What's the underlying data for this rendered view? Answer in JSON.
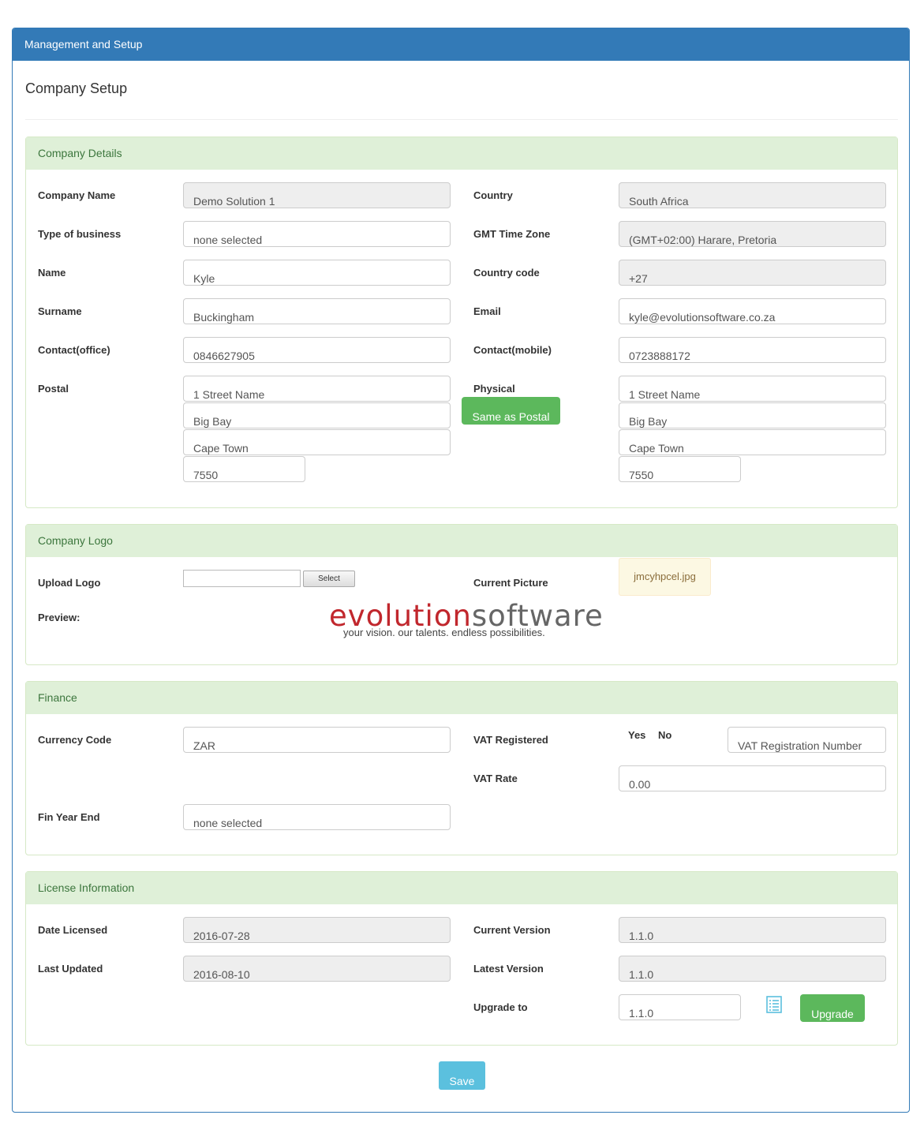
{
  "panel": {
    "title": "Management and Setup"
  },
  "page": {
    "title": "Company Setup"
  },
  "company_details": {
    "heading": "Company Details",
    "company_name": {
      "label": "Company Name",
      "value": "Demo Solution 1"
    },
    "country": {
      "label": "Country",
      "value": "South Africa"
    },
    "type_of_business": {
      "label": "Type of business",
      "value": "none selected"
    },
    "gmt_time_zone": {
      "label": "GMT Time Zone",
      "value": "(GMT+02:00) Harare, Pretoria"
    },
    "name": {
      "label": "Name",
      "value": "Kyle"
    },
    "country_code": {
      "label": "Country code",
      "value": "+27"
    },
    "surname": {
      "label": "Surname",
      "value": "Buckingham"
    },
    "email": {
      "label": "Email",
      "value": "kyle@evolutionsoftware.co.za"
    },
    "contact_office": {
      "label": "Contact(office)",
      "value": "0846627905"
    },
    "contact_mobile": {
      "label": "Contact(mobile)",
      "value": "0723888172"
    },
    "postal": {
      "label": "Postal",
      "line1": "1 Street Name",
      "line2": "Big Bay",
      "line3": "Cape Town",
      "code": "7550"
    },
    "physical": {
      "label": "Physical",
      "line1": "1 Street Name",
      "line2": "Big Bay",
      "line3": "Cape Town",
      "code": "7550"
    },
    "same_as_postal_label": "Same as Postal"
  },
  "company_logo": {
    "heading": "Company Logo",
    "upload_label": "Upload Logo",
    "select_label": "Select",
    "current_picture_label": "Current Picture",
    "current_picture_value": "jmcyhpcel.jpg",
    "preview_label": "Preview:",
    "logo_word1": "evolution",
    "logo_word2": "software",
    "logo_tagline": "your vision.  our talents.  endless possibilities."
  },
  "finance": {
    "heading": "Finance",
    "currency_code": {
      "label": "Currency Code",
      "value": "ZAR"
    },
    "vat_registered": {
      "label": "VAT Registered",
      "yes": "Yes",
      "no": "No",
      "placeholder": "VAT Registration Number"
    },
    "vat_rate": {
      "label": "VAT Rate",
      "value": "0.00"
    },
    "fin_year_end": {
      "label": "Fin Year End",
      "value": "none selected"
    }
  },
  "license": {
    "heading": "License Information",
    "date_licensed": {
      "label": "Date Licensed",
      "value": "2016-07-28"
    },
    "current_version": {
      "label": "Current Version",
      "value": "1.1.0"
    },
    "last_updated": {
      "label": "Last Updated",
      "value": "2016-08-10"
    },
    "latest_version": {
      "label": "Latest Version",
      "value": "1.1.0"
    },
    "upgrade_to": {
      "label": "Upgrade to",
      "value": "1.1.0"
    },
    "upgrade_button": "Upgrade"
  },
  "save_button": "Save",
  "icons": {
    "list": "list-icon"
  },
  "colors": {
    "primary": "#337ab7",
    "success": "#5cb85c",
    "info": "#5bc0de",
    "section_bg": "#dff0d8",
    "section_text": "#3c763d"
  }
}
